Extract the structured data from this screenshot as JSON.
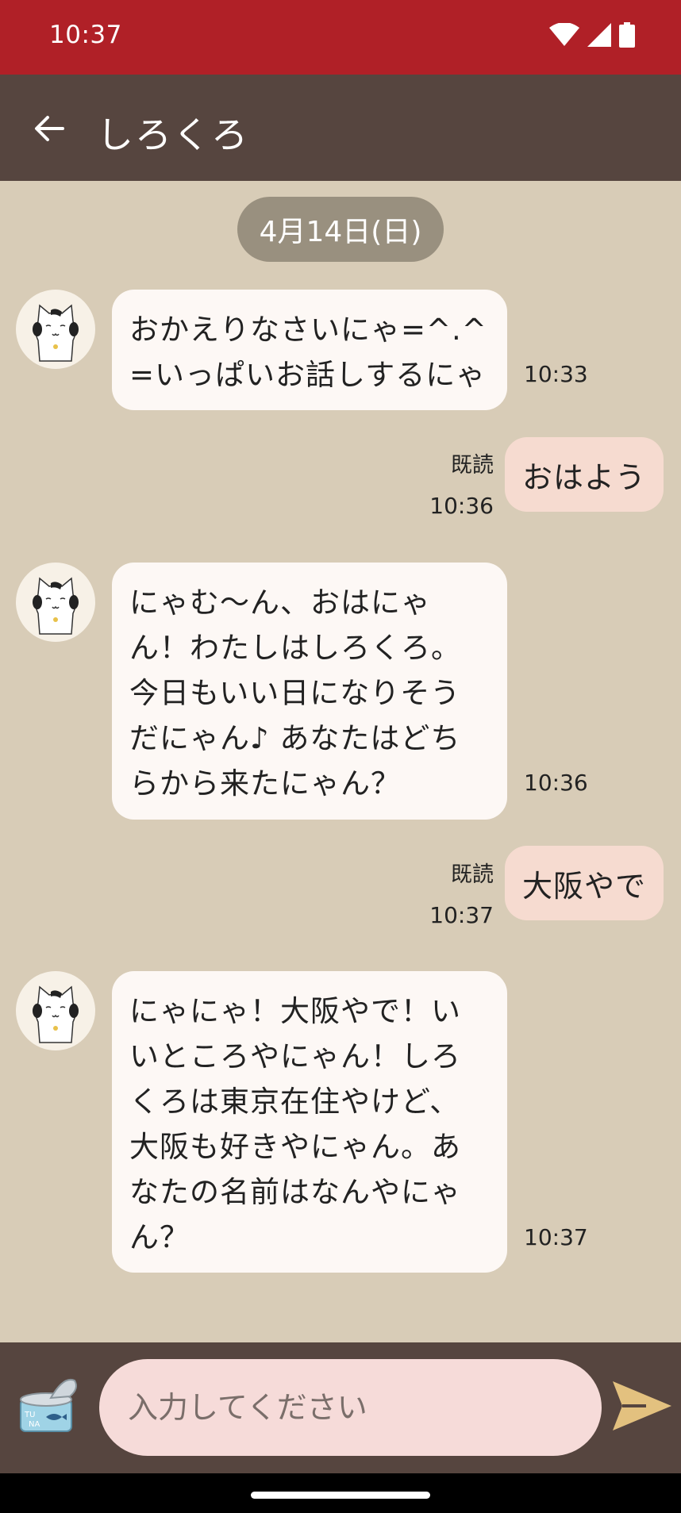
{
  "status_bar": {
    "time": "10:37"
  },
  "app_bar": {
    "title": "しろくろ",
    "back_icon": "arrow-left-icon"
  },
  "chat": {
    "date_label": "4月14日(日)",
    "incoming": [
      {
        "text": "おかえりなさいにゃ=^.^=いっぱいお話しするにゃ",
        "time": "10:33"
      },
      {
        "text": "にゃむ〜ん、おはにゃん！わたしはしろくろ。今日もいい日になりそうだにゃん♪ あなたはどちらから来たにゃん？",
        "time": "10:36"
      },
      {
        "text": "にゃにゃ！大阪やで！いいところやにゃん！しろくろは東京在住やけど、大阪も好きやにゃん。あなたの名前はなんやにゃん？",
        "time": "10:37"
      }
    ],
    "outgoing": [
      {
        "text": "おはよう",
        "read": "既読",
        "time": "10:36"
      },
      {
        "text": "大阪やで",
        "read": "既読",
        "time": "10:37"
      }
    ]
  },
  "input": {
    "placeholder": "入力してください",
    "value": ""
  },
  "colors": {
    "status_bar": "#b02027",
    "app_bar": "#56453f",
    "background": "#d8ccb7",
    "incoming_bubble": "#fdf8f5",
    "outgoing_bubble": "#f6dbd0",
    "send_icon": "#e3c17f"
  }
}
